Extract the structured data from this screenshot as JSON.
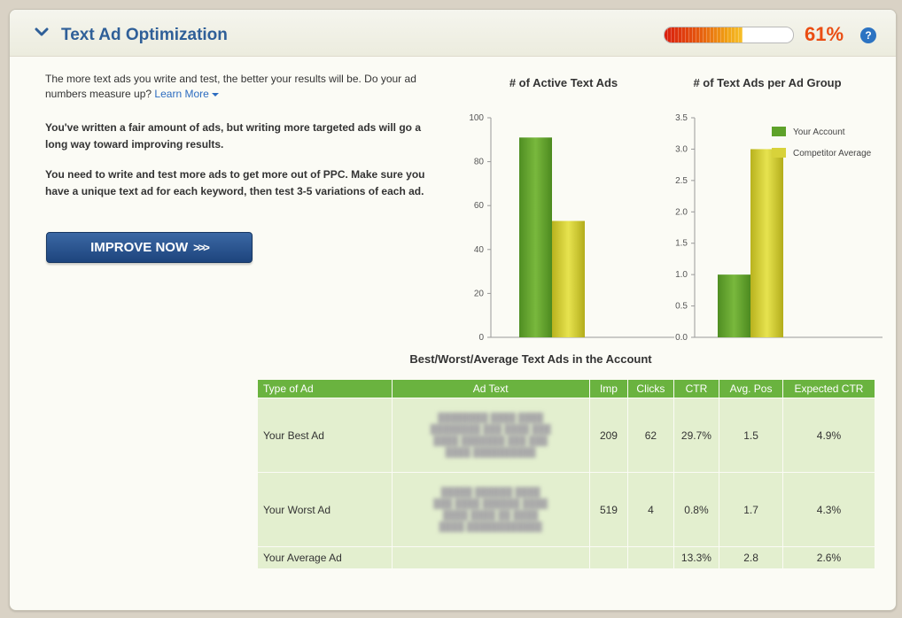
{
  "header": {
    "title": "Text Ad Optimization",
    "score_percent": 61,
    "score_label": "61%",
    "help_label": "?"
  },
  "intro": {
    "text": "The more text ads you write and test, the better your results will be. Do your ad numbers measure up?",
    "learn_more": "Learn More"
  },
  "messages": [
    "You've written a fair amount of ads, but writing more targeted ads will go a long way toward improving results.",
    "You need to write and test more ads to get more out of PPC. Make sure you have a unique text ad for each keyword, then test 3-5 variations of each ad."
  ],
  "improve_button": {
    "label": "IMPROVE NOW",
    "arrows": ">>>"
  },
  "colors": {
    "green": "#6aa82f",
    "yellow": "#d8d23a",
    "title_blue": "#2f5f98",
    "score_orange": "#ea4d13"
  },
  "chart_data": [
    {
      "type": "bar",
      "title": "# of Active Text Ads",
      "categories": [
        "Your Account",
        "Competitor Average"
      ],
      "values": [
        91,
        53
      ],
      "ylim": [
        0,
        100
      ],
      "yticks": [
        "0",
        "20",
        "40",
        "60",
        "80",
        "100"
      ]
    },
    {
      "type": "bar",
      "title": "# of Text Ads per Ad Group",
      "categories": [
        "Your Account",
        "Competitor Average"
      ],
      "values": [
        1.0,
        3.0
      ],
      "ylim": [
        0,
        3.5
      ],
      "yticks": [
        "0.0",
        "0.5",
        "1.0",
        "1.5",
        "2.0",
        "2.5",
        "3.0",
        "3.5"
      ],
      "legend": [
        "Your Account",
        "Competitor Average"
      ],
      "legend_position": "top-right"
    }
  ],
  "table": {
    "title": "Best/Worst/Average Text Ads in the Account",
    "columns": [
      "Type of Ad",
      "Ad Text",
      "Imp",
      "Clicks",
      "CTR",
      "Avg. Pos",
      "Expected CTR"
    ],
    "rows": [
      {
        "type": "Your Best Ad",
        "ad_text_blurred": "blurred ad text",
        "imp": "209",
        "clicks": "62",
        "ctr": "29.7%",
        "avg_pos": "1.5",
        "expected_ctr": "4.9%"
      },
      {
        "type": "Your Worst Ad",
        "ad_text_blurred": "blurred ad text",
        "imp": "519",
        "clicks": "4",
        "ctr": "0.8%",
        "avg_pos": "1.7",
        "expected_ctr": "4.3%"
      },
      {
        "type": "Your Average Ad",
        "ad_text_blurred": "",
        "imp": "",
        "clicks": "",
        "ctr": "13.3%",
        "avg_pos": "2.8",
        "expected_ctr": "2.6%"
      }
    ]
  }
}
